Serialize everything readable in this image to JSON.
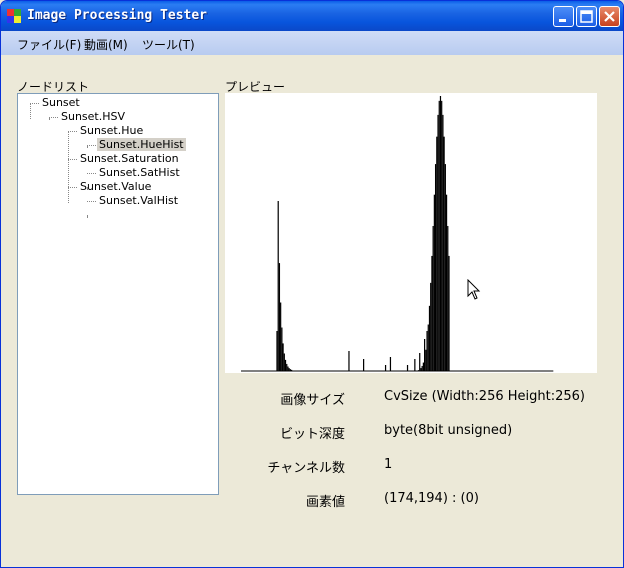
{
  "window": {
    "title": "Image Processing Tester"
  },
  "menu": [
    "ファイル(F)",
    "動画(M)",
    "ツール(T)"
  ],
  "panels": {
    "tree_label": "ノードリスト",
    "preview_label": "プレビュー"
  },
  "tree": [
    {
      "label": "Sunset",
      "depth": 0,
      "selected": false
    },
    {
      "label": "Sunset.HSV",
      "depth": 1,
      "selected": false
    },
    {
      "label": "Sunset.Hue",
      "depth": 2,
      "selected": false
    },
    {
      "label": "Sunset.HueHist",
      "depth": 3,
      "selected": true
    },
    {
      "label": "Sunset.Saturation",
      "depth": 2,
      "selected": false
    },
    {
      "label": "Sunset.SatHist",
      "depth": 3,
      "selected": false
    },
    {
      "label": "Sunset.Value",
      "depth": 2,
      "selected": false
    },
    {
      "label": "Sunset.ValHist",
      "depth": 3,
      "selected": false
    }
  ],
  "info": [
    {
      "label": "画像サイズ",
      "value": "CvSize (Width:256 Height:256)"
    },
    {
      "label": "ビット深度",
      "value": "byte(8bit unsigned)"
    },
    {
      "label": "チャンネル数",
      "value": "1"
    },
    {
      "label": "画素値",
      "value": "(174,194) : (0)"
    }
  ],
  "colors": {
    "titlebar": "#0a5ee8",
    "selection": "#d4d0c8",
    "histogram": "#000000"
  },
  "histogram": {
    "bins": 256,
    "description_values": {
      "peak_left_bin": 32,
      "peak_right_bin": 165,
      "small_spikes_bins": [
        88,
        100,
        118,
        122,
        136,
        142,
        146,
        150,
        152,
        155
      ]
    }
  }
}
